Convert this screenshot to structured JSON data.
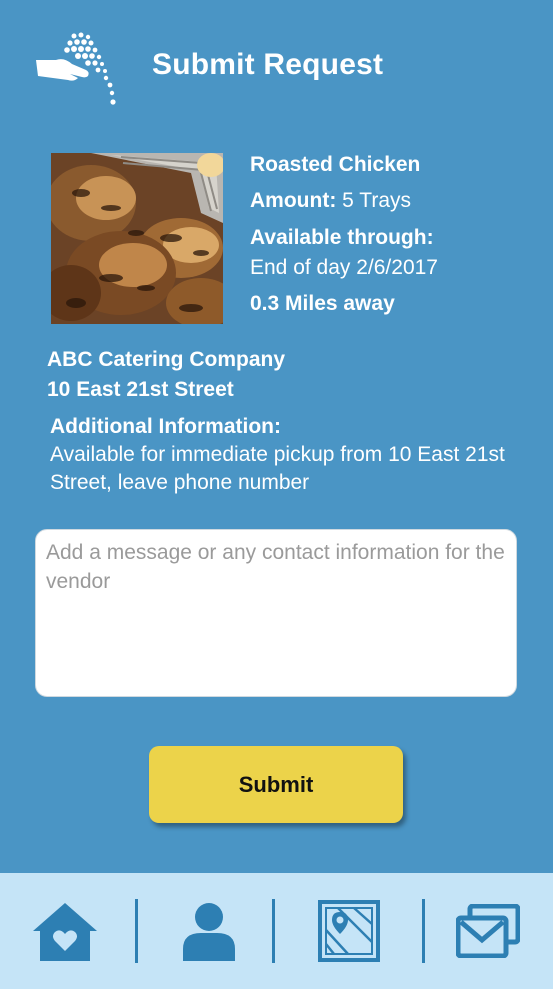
{
  "header": {
    "title": "Submit Request",
    "logo_icon": "hand-giving-icon"
  },
  "listing": {
    "item_name": "Roasted Chicken",
    "amount_label": "Amount:",
    "amount_value": "5 Trays",
    "available_label": "Available through:",
    "available_value": "End of day 2/6/2017",
    "distance": "0.3 Miles away",
    "photo_icon": "roasted-chicken-photo"
  },
  "vendor": {
    "name": "ABC Catering Company",
    "address": "10 East 21st Street"
  },
  "additional": {
    "label": "Additional Information:",
    "text": "Available for immediate pickup from 10 East 21st Street, leave phone number"
  },
  "message": {
    "placeholder": "Add a message or any contact information for the vendor",
    "value": ""
  },
  "submit_label": "Submit",
  "nav": [
    {
      "icon": "home-heart-icon"
    },
    {
      "icon": "person-icon"
    },
    {
      "icon": "map-icon"
    },
    {
      "icon": "messages-icon"
    }
  ],
  "colors": {
    "background": "#4a95c5",
    "nav_background": "#c5e4f7",
    "icon": "#2d7fb3",
    "button": "#ecd34a"
  }
}
